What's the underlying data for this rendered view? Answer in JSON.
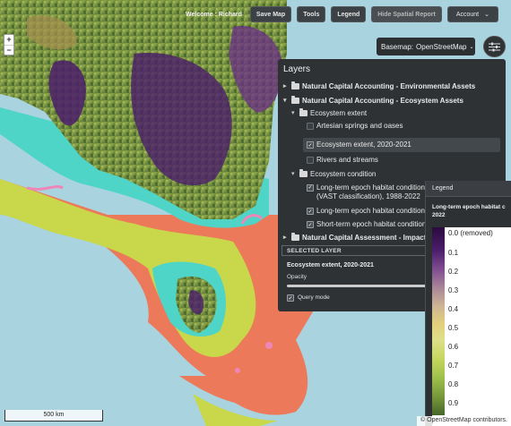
{
  "topbar": {
    "welcome": "Welcome : Richard",
    "save_map": "Save Map",
    "tools": "Tools",
    "legend": "Legend",
    "hide_spatial_report": "Hide Spatial Report",
    "account": "Account"
  },
  "zoom": {
    "in": "+",
    "out": "−"
  },
  "basemap": {
    "label": "Basemap:",
    "value": "OpenStreetMap"
  },
  "layers_panel": {
    "title": "Layers",
    "group1": "Natural Capital Accounting - Environmental Assets",
    "group2": "Natural Capital Accounting - Ecosystem Assets",
    "sub1": "Ecosystem extent",
    "item_artesian": "Artesian springs and oases",
    "item_extent": "Ecosystem extent, 2020-2021",
    "item_rivers": "Rivers and streams",
    "sub2": "Ecosystem condition",
    "item_vast": "Long-term epoch habitat condition index (VAST classification), 1988-2022",
    "item_long": "Long-term epoch habitat condition",
    "item_short": "Short-term epoch habitat condition",
    "group3": "Natural Capital Assessment - Impacts",
    "selected_layer_label": "SELECTED LAYER",
    "selected_layer_name": "Ecosystem extent, 2020-2021",
    "opacity_label": "Opacity",
    "query_mode": "Query mode"
  },
  "legend_panel": {
    "header": "Legend",
    "title_line1": "Long-term epoch habitat c",
    "title_line2": "2022",
    "ticks": [
      "0.0 (removed)",
      "0.1",
      "0.2",
      "0.3",
      "0.4",
      "0.5",
      "0.6",
      "0.7",
      "0.8",
      "0.9"
    ]
  },
  "scale": "500 km",
  "attribution": "© OpenStreetMap contributors."
}
